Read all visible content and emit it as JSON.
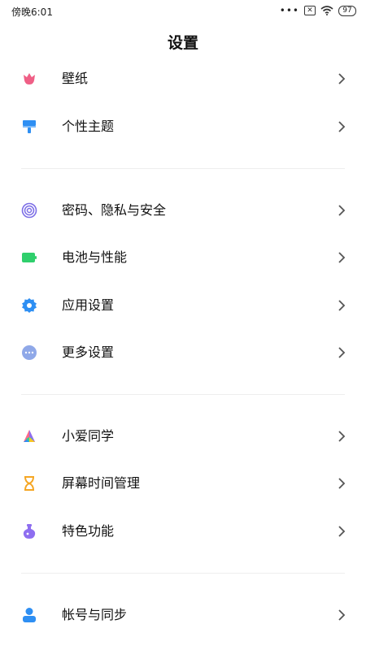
{
  "status": {
    "time": "傍晚6:01",
    "battery": "97"
  },
  "title": "设置",
  "items": [
    {
      "label": "壁纸",
      "icon": "tulip-icon",
      "color": "#ef5f86"
    },
    {
      "label": "个性主题",
      "icon": "paint-roller-icon",
      "color": "#2e8ff3"
    },
    {
      "label": "密码、隐私与安全",
      "icon": "fingerprint-icon",
      "color": "#7c6ee6"
    },
    {
      "label": "电池与性能",
      "icon": "battery-icon",
      "color": "#2fcf6c"
    },
    {
      "label": "应用设置",
      "icon": "gear-icon",
      "color": "#2e8ff3"
    },
    {
      "label": "更多设置",
      "icon": "more-dots-icon",
      "color": "#8fa8e8"
    },
    {
      "label": "小爱同学",
      "icon": "xiaoai-icon",
      "color": "#ff6a8a"
    },
    {
      "label": "屏幕时间管理",
      "icon": "hourglass-icon",
      "color": "#f5a623"
    },
    {
      "label": "特色功能",
      "icon": "flask-icon",
      "color": "#8e6ef0"
    },
    {
      "label": "帐号与同步",
      "icon": "person-icon",
      "color": "#2e8ff3"
    }
  ]
}
